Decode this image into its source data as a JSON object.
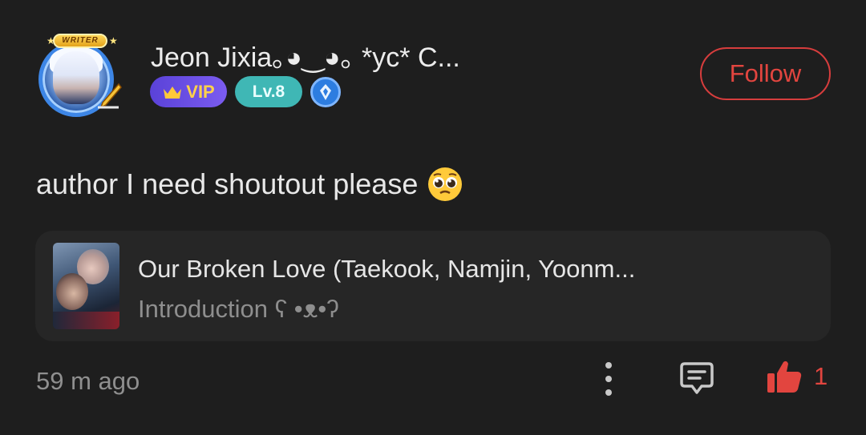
{
  "author": {
    "name": "Jeon Jixia｡◕‿◕｡ *yc* C...",
    "avatar_banner": "WRITER",
    "badges": {
      "vip_label": "VIP",
      "level_label": "Lv.8"
    },
    "follow_label": "Follow"
  },
  "comment": {
    "text": "author I need shoutout please"
  },
  "book": {
    "title": "Our Broken Love (Taekook, Namjin, Yoonm...",
    "chapter": "Introduction ʕ •ᴥ•ʔ"
  },
  "footer": {
    "timestamp": "59 m ago",
    "like_count": "1"
  },
  "colors": {
    "background": "#1e1e1e",
    "card": "#262626",
    "accent_red": "#e2453f",
    "vip_purple": "#6a4fe6",
    "level_teal": "#3fb7b5",
    "gem_blue": "#2d7de0"
  },
  "icons": [
    "writer-avatar-frame",
    "crown-icon",
    "gem-icon",
    "pleading-face-emoji",
    "more-vertical-icon",
    "comment-reply-icon",
    "thumbs-up-icon"
  ]
}
